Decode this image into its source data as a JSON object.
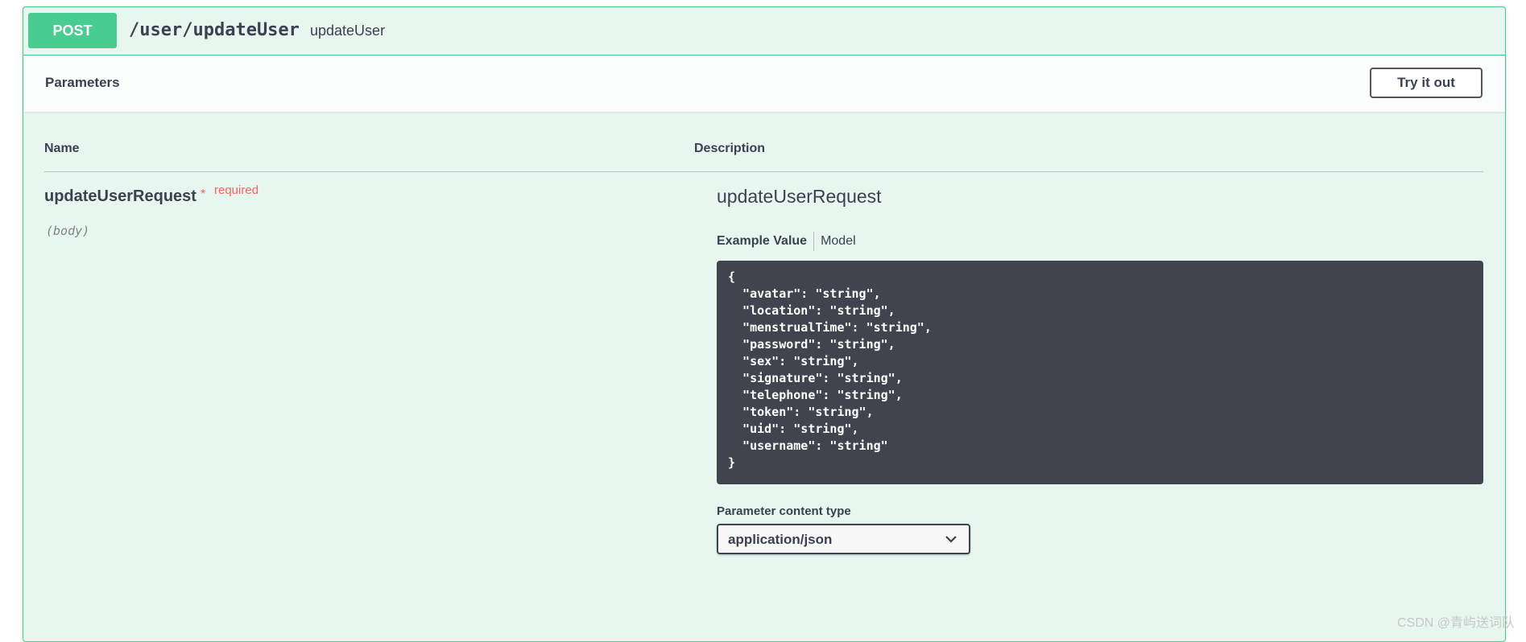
{
  "operation": {
    "method": "POST",
    "path": "/user/updateUser",
    "operation_id": "updateUser"
  },
  "parameters": {
    "title": "Parameters",
    "try_it_out_label": "Try it out",
    "columns": {
      "name": "Name",
      "description": "Description"
    },
    "param": {
      "name": "updateUserRequest",
      "required_star": "*",
      "required_label": "required",
      "location": "(body)",
      "description": "updateUserRequest"
    },
    "example_tabs": {
      "example_value": "Example Value",
      "model": "Model"
    },
    "example_json": "{\n  \"avatar\": \"string\",\n  \"location\": \"string\",\n  \"menstrualTime\": \"string\",\n  \"password\": \"string\",\n  \"sex\": \"string\",\n  \"signature\": \"string\",\n  \"telephone\": \"string\",\n  \"token\": \"string\",\n  \"uid\": \"string\",\n  \"username\": \"string\"\n}",
    "content_type_label": "Parameter content type",
    "content_type_value": "application/json"
  },
  "watermark": "CSDN @青屿送词队",
  "colors": {
    "post": "#49cc90",
    "post_bg": "#e8f6f0",
    "code_bg": "#41444e",
    "required": "#ff6060"
  }
}
